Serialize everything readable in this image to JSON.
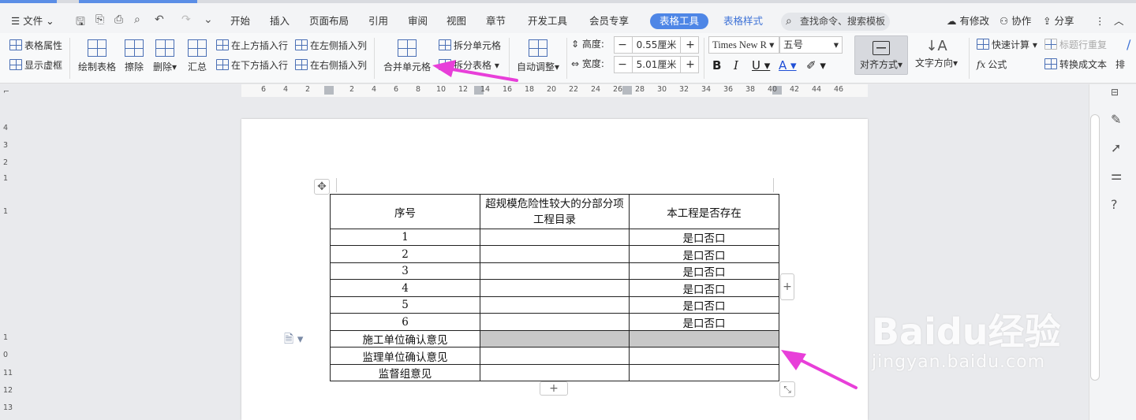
{
  "menu": {
    "file": "文件",
    "tabs": [
      "开始",
      "插入",
      "页面布局",
      "引用",
      "审阅",
      "视图",
      "章节",
      "开发工具",
      "会员专享"
    ],
    "active_tab": "表格工具",
    "style_tab": "表格样式",
    "search_placeholder": "查找命令、搜索模板",
    "modified": "有修改",
    "collab": "协作",
    "share": "分享"
  },
  "ribbon": {
    "table_props": "表格属性",
    "show_gridlines": "显示虚框",
    "draw_table": "绘制表格",
    "erase": "擦除",
    "delete": "删除",
    "summary": "汇总",
    "insert_above": "在上方插入行",
    "insert_below": "在下方插入行",
    "insert_left": "在左侧插入列",
    "insert_right": "在右侧插入列",
    "merge_cells": "合并单元格",
    "split_cells": "拆分单元格",
    "split_table": "拆分表格",
    "auto_fit": "自动调整",
    "height_label": "高度:",
    "height_value": "0.55厘米",
    "width_label": "宽度:",
    "width_value": "5.01厘米",
    "font_name": "Times New R",
    "font_size": "五号",
    "align": "对齐方式",
    "text_direction": "文字方向",
    "quick_calc": "快速计算",
    "title_repeat": "标题行重复",
    "formula": "公式",
    "convert_text": "转换成文本",
    "more": "排"
  },
  "ruler": {
    "h_ticks": [
      "6",
      "4",
      "2",
      "2",
      "4",
      "6",
      "8",
      "10",
      "12",
      "14",
      "16",
      "18",
      "20",
      "22",
      "24",
      "26",
      "28",
      "30",
      "32",
      "34",
      "36",
      "38",
      "40",
      "42",
      "44",
      "46"
    ],
    "v_ticks": [
      "4",
      "3",
      "2",
      "1",
      "1",
      "1",
      "0",
      "11",
      "12",
      "13"
    ]
  },
  "table": {
    "header": [
      "序号",
      "超规模危险性较大的分部分项工程目录",
      "本工程是否存在"
    ],
    "rows": [
      [
        "1",
        "",
        "是口否口"
      ],
      [
        "2",
        "",
        "是口否口"
      ],
      [
        "3",
        "",
        "是口否口"
      ],
      [
        "4",
        "",
        "是口否口"
      ],
      [
        "5",
        "",
        "是口否口"
      ],
      [
        "6",
        "",
        "是口否口"
      ],
      [
        "施工单位确认意见",
        "",
        ""
      ],
      [
        "监理单位确认意见",
        "",
        ""
      ],
      [
        "监督组意见",
        "",
        ""
      ]
    ]
  },
  "watermark": {
    "line1": "Baidu经验",
    "line2": "jingyan.baidu.com"
  },
  "colors": {
    "accent": "#4e86e6",
    "arrow": "#e83fd9",
    "selected_cell": "#c8c8c8"
  }
}
